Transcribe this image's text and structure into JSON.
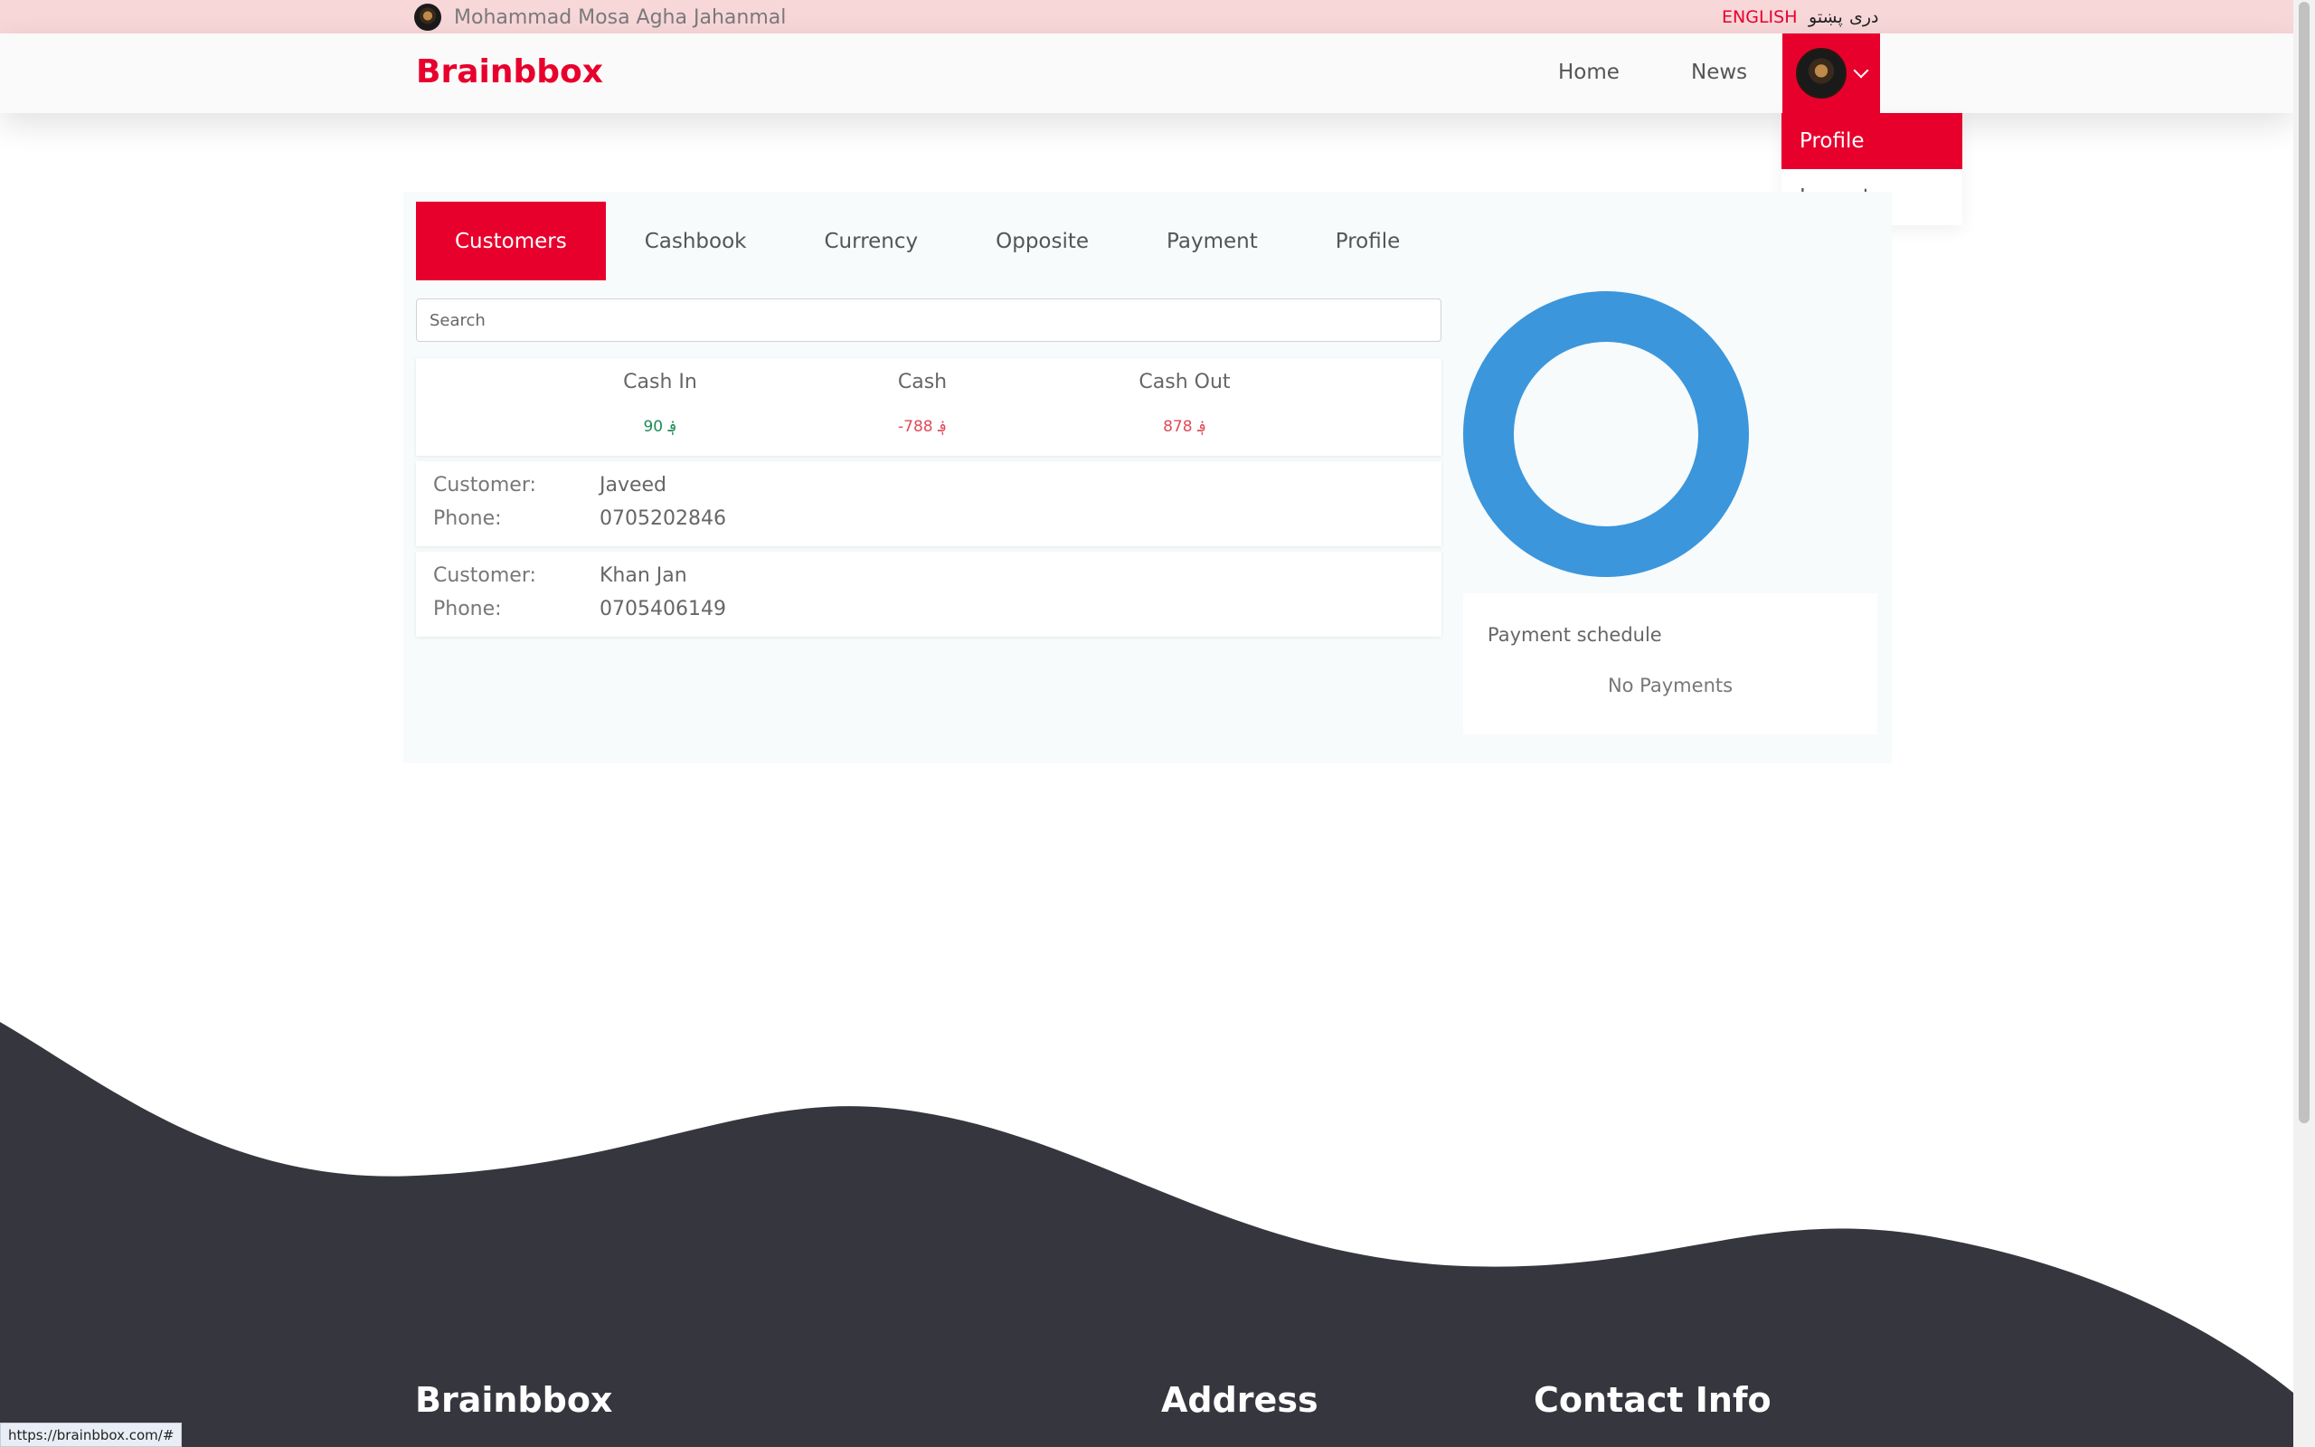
{
  "topbar": {
    "user_name": "Mohammad Mosa Agha Jahanmal",
    "languages": {
      "english": "ENGLISH",
      "pashto": "پښتو",
      "dari": "دری"
    }
  },
  "nav": {
    "brand": "Brainbbox",
    "home": "Home",
    "news": "News"
  },
  "dropdown": {
    "profile": "Profile",
    "logout": "Logout"
  },
  "tabs": [
    {
      "label": "Customers"
    },
    {
      "label": "Cashbook"
    },
    {
      "label": "Currency"
    },
    {
      "label": "Opposite"
    },
    {
      "label": "Payment"
    },
    {
      "label": "Profile"
    }
  ],
  "search": {
    "placeholder": "Search"
  },
  "summary": {
    "cash_in_label": "Cash In",
    "cash_in_value": "90 ؋",
    "cash_label": "Cash",
    "cash_value": "-788 ؋",
    "cash_out_label": "Cash Out",
    "cash_out_value": "878 ؋"
  },
  "customers": [
    {
      "customer_label": "Customer:",
      "name": "Javeed",
      "phone_label": "Phone:",
      "phone": "0705202846"
    },
    {
      "customer_label": "Customer:",
      "name": "Khan Jan",
      "phone_label": "Phone:",
      "phone": "0705406149"
    }
  ],
  "schedule": {
    "title": "Payment schedule",
    "empty": "No Payments"
  },
  "footer": {
    "brand": "Brainbbox",
    "address": "Address",
    "contact": "Contact Info"
  },
  "status_url": "https://brainbbox.com/#",
  "colors": {
    "accent": "#e8002d",
    "donut": "#3b96dc",
    "footer": "#36363e",
    "topbar": "#f8d7d9"
  }
}
